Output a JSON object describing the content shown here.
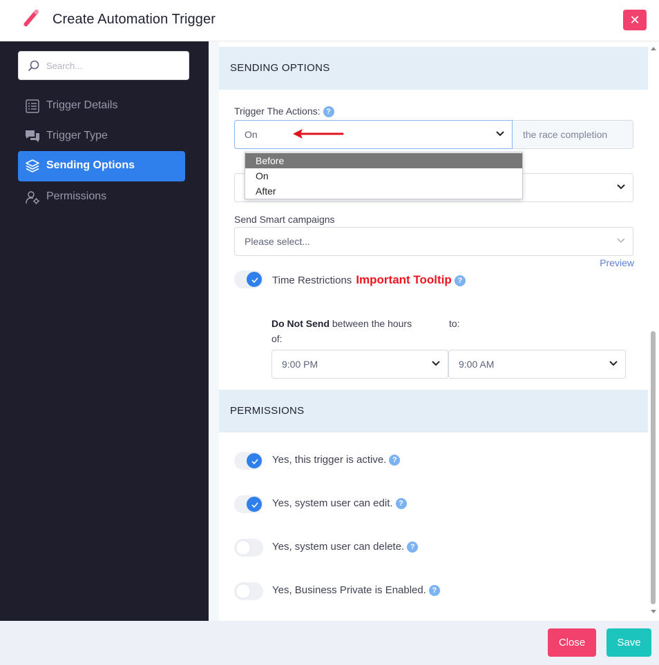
{
  "header": {
    "title": "Create Automation Trigger",
    "close_symbol": "✕"
  },
  "sidebar": {
    "search_placeholder": "Search...",
    "items": [
      {
        "label": "Trigger Details",
        "icon": "list-icon"
      },
      {
        "label": "Trigger Type",
        "icon": "chat-bubbles-icon"
      },
      {
        "label": "Sending Options",
        "icon": "layers-icon",
        "active": true
      },
      {
        "label": "Permissions",
        "icon": "user-gear-icon"
      }
    ]
  },
  "sending_options": {
    "title": "SENDING OPTIONS",
    "trigger_label": "Trigger The Actions:",
    "trigger_value": "On",
    "trigger_addon": "the race completion",
    "trigger_options": [
      "Before",
      "On",
      "After"
    ],
    "trigger_highlighted": "Before",
    "smart_label": "Send Smart campaigns",
    "smart_placeholder": "Please select...",
    "preview_link": "Preview",
    "time_restrictions_label": "Time Restrictions",
    "important_tooltip": "Important Tooltip",
    "do_not_send_bold": "Do Not Send",
    "do_not_send_rest": "between the hours",
    "of_label": "of:",
    "to_label": "to:",
    "from_time": "9:00 PM",
    "to_time": "9:00 AM"
  },
  "permissions": {
    "title": "PERMISSIONS",
    "toggles": [
      {
        "label": "Yes, this trigger is active.",
        "on": true
      },
      {
        "label": "Yes, system user can edit.",
        "on": true
      },
      {
        "label": "Yes, system user can delete.",
        "on": false
      },
      {
        "label": "Yes, Business Private is Enabled.",
        "on": false
      }
    ]
  },
  "footer": {
    "close_label": "Close",
    "save_label": "Save"
  },
  "colors": {
    "accent": "#2f80ed",
    "danger": "#f1416c",
    "success": "#1bc5bd",
    "sidebar_bg": "#1e1e2d",
    "section_bg": "#e4eef7",
    "annotation_arrow": "#e0141e"
  }
}
